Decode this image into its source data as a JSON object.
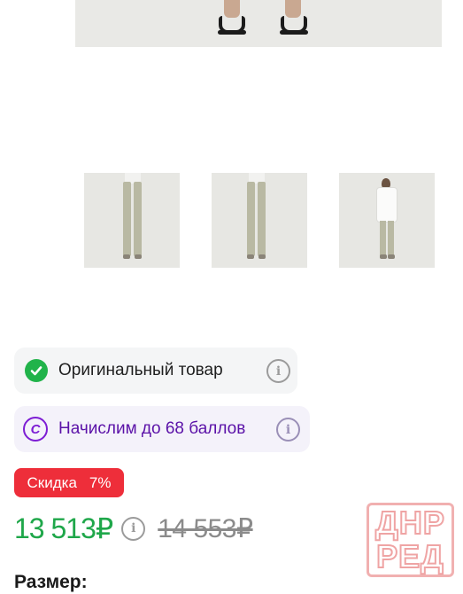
{
  "badges": {
    "original": {
      "label": "Оригинальный товар"
    },
    "points": {
      "label": "Начислим до 68 баллов",
      "icon_letter": "C"
    }
  },
  "discount": {
    "label": "Скидка",
    "value": "7%"
  },
  "price": {
    "current": "13 513₽",
    "old": "14 553₽"
  },
  "size": {
    "label": "Размер:"
  },
  "icons": {
    "info": "info-icon",
    "check": "check-circle-icon",
    "points": "points-coin-icon"
  },
  "colors": {
    "price_green": "#1fa74a",
    "discount_red": "#ee2e3a",
    "points_purple": "#7d1dd4",
    "check_green": "#21b34a"
  },
  "watermark": {
    "line1": "ДНР",
    "line2": "РЕД"
  }
}
